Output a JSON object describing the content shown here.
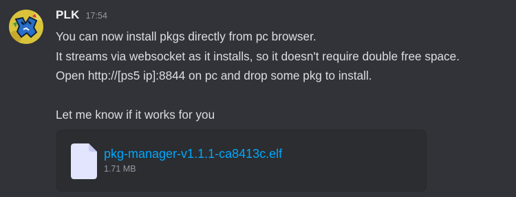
{
  "message": {
    "username": "PLK",
    "timestamp": "17:54",
    "avatar_icon": "blue-creature-avatar-icon",
    "lines": [
      "You can now install pkgs directly from pc browser.",
      "It streams via websocket as it installs, so it doesn't require double free space.",
      "Open http://[ps5 ip]:8844  on pc and drop some pkg to install.",
      "",
      "Let me know if it works for you"
    ]
  },
  "attachment": {
    "icon": "file-icon",
    "file_name": "pkg-manager-v1.1.1-ca8413c.elf",
    "file_size": "1.71 MB"
  },
  "colors": {
    "background": "#313338",
    "text": "#dbdee1",
    "muted": "#949ba4",
    "link": "#00a8fc",
    "attachment_bg": "#2b2d31",
    "file_icon": "#e3e5ff"
  }
}
